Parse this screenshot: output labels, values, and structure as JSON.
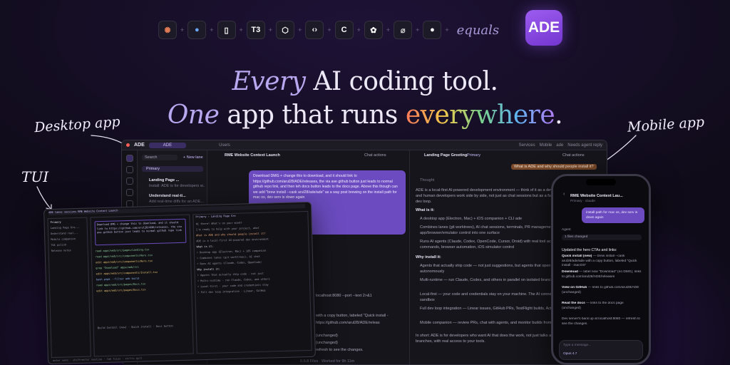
{
  "logos": {
    "tools": [
      {
        "name": "claude-icon",
        "glyph": "✺",
        "color": "#e07a55"
      },
      {
        "name": "cursor-agent-icon",
        "glyph": "●",
        "color": "#6aa5f5"
      },
      {
        "name": "opencode-icon",
        "glyph": "▯",
        "color": "#ffffff"
      },
      {
        "name": "t3-icon",
        "glyph": "T3",
        "color": "#ffffff"
      },
      {
        "name": "cube-icon",
        "glyph": "⬡",
        "color": "#ffffff"
      },
      {
        "name": "codex-icon",
        "glyph": "‹›",
        "color": "#ffffff"
      },
      {
        "name": "c-icon",
        "glyph": "C",
        "color": "#ffffff"
      },
      {
        "name": "openai-icon",
        "glyph": "✿",
        "color": "#ffffff"
      },
      {
        "name": "paperclip-icon",
        "glyph": "⌀",
        "color": "#d0d0d0"
      },
      {
        "name": "github-icon",
        "glyph": "●",
        "color": "#ffffff"
      }
    ],
    "equals": "equals",
    "ade": "ADE"
  },
  "headline": {
    "line1_em": "Every",
    "line1_rest": " AI coding tool.",
    "line2_em": "One",
    "line2_mid": " app that runs ",
    "line2_grad": "everywhere",
    "line2_end": "."
  },
  "labels": {
    "desktop": "Desktop app",
    "tui": "TUI",
    "mobile": "Mobile app"
  },
  "desktop": {
    "brand": "ADE",
    "tab_active": "ADE",
    "tab_other": "Users",
    "status_items": [
      "Services",
      "Mobile",
      "ade",
      "Needs agent reply"
    ],
    "sidebar_search": "Search",
    "new_button": "+ New lane",
    "lane_primary": "Primary",
    "lanes": [
      {
        "title": "Landing Page ...",
        "sub": "Install: ADE is for developers w..."
      },
      {
        "title": "Understand real-ti...",
        "sub": "Add real-time diffs for an ADE..."
      }
    ],
    "chat_left_title": "RME Website Context Launch",
    "chat_right_title": "Landing Page Greeting",
    "chat_options": "Chat actions",
    "primary_badge": "Primary",
    "prompt_bubble": "Download DMG + change this to download, and it should link to https://github.com/arul28/ADE/releases, the via ave github button just leads to normal github repo link, and then teh docs button leads to the docs page. Above this though can we add \"brew install --cask arul28/ade/ade\" as a way post brewing on the install path for mac os, dev serv is down again",
    "right_user_msg": "What is ADE and why should people install it?",
    "thought": "Thought",
    "answer_intro": "ADE is a local-first AI-powered development environment — think of it as a dev workspace where AI agents and human developers work side by side, not just as chat sessions but as a full app that reflects your actual dev loop.",
    "what_is_it": "What is it:",
    "what_items": [
      "A desktop app (Electron, Mac) + iOS companion + CLI  ade",
      "Combines lanes (git worktrees), AI chat sessions, terminals, PR management, and an app/browser/emulator control into one surface",
      "Runs AI agents (Claude, Codex, OpenCode, Cursor, Droid) with real tool access — file edits, shell commands, browser automation, iOS simulator control"
    ],
    "why_install": "Why install it:",
    "why_items": [
      "Agents that actually ship code — not just suggestions, but agents that open PRs and iterate autonomously",
      "Multi-runtime — run Claude, Codex, and others in parallel on isolated branches, each in its own context",
      "Local-first — your code and credentials stay on your machine. The AI connects to your CLI, not a cloud sandbox",
      "Full dev loop integration — Linear issues, GitHub PRs, TestFlight builds, Actions, all wired in",
      "Mobile companion — review PRs, chat with agents, and monitor builds from your phone"
    ],
    "answer_outro": "In short: ADE is for developers who want AI that does the work, not just talks about it — on your own branches, with real access to your tools.",
    "mid_lines": [
      "localhost:8080 --port --text 2>&1",
      "with a copy button, labeled \"Quick install -",
      "https://github.com/arul28/ADE/releas",
      "(unchanged)",
      "(unchanged)",
      "refresh to see the changes."
    ],
    "footer_left": "0.6.8 Files",
    "footer_right": "Worked for 9h 11m"
  },
  "tui": {
    "header": "ADE  lanes  sessions  RME Website Context Launch",
    "lane_items": [
      "Primary",
      "Landing Page Gre...",
      "Understand real...",
      "Mobile companion",
      "TUI polish",
      "Release notes"
    ],
    "user_prompt": "Download DMG + change this to download, and it should link to https://github.com/arul28/ADE/releases, the via ave github button just leads to normal github repo link",
    "tool_lines": [
      "read  apps/web/src/pages/Landing.tsx",
      "read  apps/web/src/components/Hero.tsx",
      "edit  apps/web/src/components/Hero.tsx",
      "grep  \"Download\" apps/web/src",
      "edit  apps/web/src/components/Install.tsx",
      "bash  pnpm --filter web build",
      "read  apps/web/src/pages/Docs.tsx",
      "edit  apps/web/src/pages/Docs.tsx"
    ],
    "right_title": "Primary › Landing Page Gre",
    "right_lines": [
      "Hi there! What's on your mind?",
      "I'm ready to help with your project, what",
      "What is ADE and why should people install it?",
      "ADE is a local-first AI-powered dev environment",
      "What is it:",
      "• Desktop app (Electron, Mac) + iOS companion",
      "• Combines lanes (git worktrees), AI chat",
      "• Runs AI agents (Claude, Codex, OpenCode)",
      "Why install it:",
      "• Agents that actually ship code - not just",
      "• Multi-runtime - run Claude, Codex, and others",
      "• Local-first - your code and credentials stay",
      "• Full dev loop integration - Linear, GitHub"
    ],
    "bottom_note": "Build Install (new) · Quick install · Docs button",
    "footer": "enter send · shift+enter newline · tab focus · ctrl+c quit"
  },
  "mobile": {
    "title": "RME Website Context Lau...",
    "sub": "Primary · claude",
    "bubble": "install path for mac os, dev serv is down again",
    "agent": "Agent",
    "files": "1 files changed",
    "heading": "Updated the hero CTAs and links:",
    "items": [
      {
        "b": "Quick install (new)",
        "t": " — brew install --cask arul28/ade/ade with a copy button, labeled \"Quick install - macOS\""
      },
      {
        "b": "Download",
        "t": " — label now \"Download\" (no DMG), links to github.com/arul28/ADE/releases"
      },
      {
        "b": "View on GitHub",
        "t": " — links to github.com/arul28/ADE (unchanged)"
      },
      {
        "b": "Read the docs",
        "t": " — links to the docs page (unchanged)"
      }
    ],
    "outro": "Dev server's back up at localhost:8080 — refresh to see the changes.",
    "input_placeholder": "Type a message...",
    "model": "Opus 4.7"
  },
  "colors": {
    "accent": "#7b4fd6",
    "bg": "#0f0b18",
    "bubble": "#6b4bbf"
  }
}
